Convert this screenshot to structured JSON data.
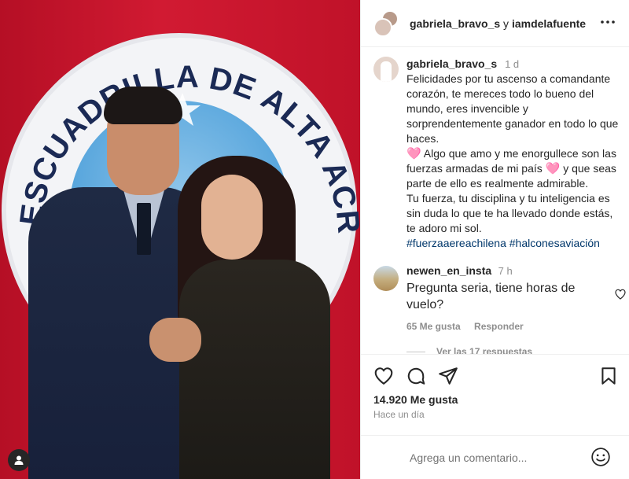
{
  "post": {
    "photo_alt": "Man in air force uniform and woman in dark blouse in front of an acrobatic squadron emblem",
    "emblem_text": "ESCUADRILLA DE ALTA ACROBACIA"
  },
  "header": {
    "user1": "gabriela_bravo_s",
    "connector": " y ",
    "user2": "iamdelafuente"
  },
  "caption": {
    "username": "gabriela_bravo_s",
    "time": "1 d",
    "text1": "Felicidades por tu ascenso a comandante corazón, te mereces todo lo bueno del mundo, eres invencible y sorprendentemente ganador en todo lo que haces.",
    "emoji": "🩷",
    "text2a": "  Algo que amo y me enorgullece son las fuerzas armadas de mi país ",
    "text2b": " y que seas parte de ello es realmente admirable.",
    "text3": "Tu fuerza, tu disciplina y tu inteligencia es sin duda lo que te ha llevado donde estás, te adoro mi sol.",
    "hashtags": "#fuerzaaereachilena #halconesaviación"
  },
  "comment": {
    "username": "newen_en_insta",
    "time": "7 h",
    "text": "Pregunta seria, tiene horas de vuelo?",
    "likes": "65 Me gusta",
    "reply_label": "Responder",
    "view_replies": "Ver las 17 respuestas"
  },
  "actions": {
    "likes_count": "14.920 Me gusta",
    "time_ago": "Hace un día"
  },
  "add_comment": {
    "placeholder": "Agrega un comentario..."
  },
  "colors": {
    "text": "#262626",
    "muted": "#8e8e8e",
    "hashtag": "#00376b",
    "border": "#efefef"
  }
}
